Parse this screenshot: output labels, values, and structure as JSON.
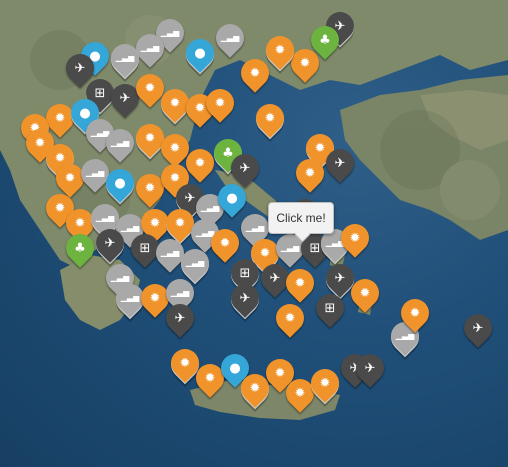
{
  "map": {
    "popup_text": "Click me!",
    "colors": {
      "sea": "#1f4f78",
      "land": "#7d8a6a",
      "solar": "#f0932b",
      "grey": "#a9a9a9",
      "dark": "#4a4a4a",
      "blue": "#35a6d8",
      "green": "#6db33f"
    },
    "icon_names": {
      "solar": "sun-icon",
      "grey": "signal-bars-icon",
      "dark": "airplane-icon",
      "windows": "windows-icon",
      "blue": "water-drop-icon",
      "green": "tree-icon"
    }
  }
}
